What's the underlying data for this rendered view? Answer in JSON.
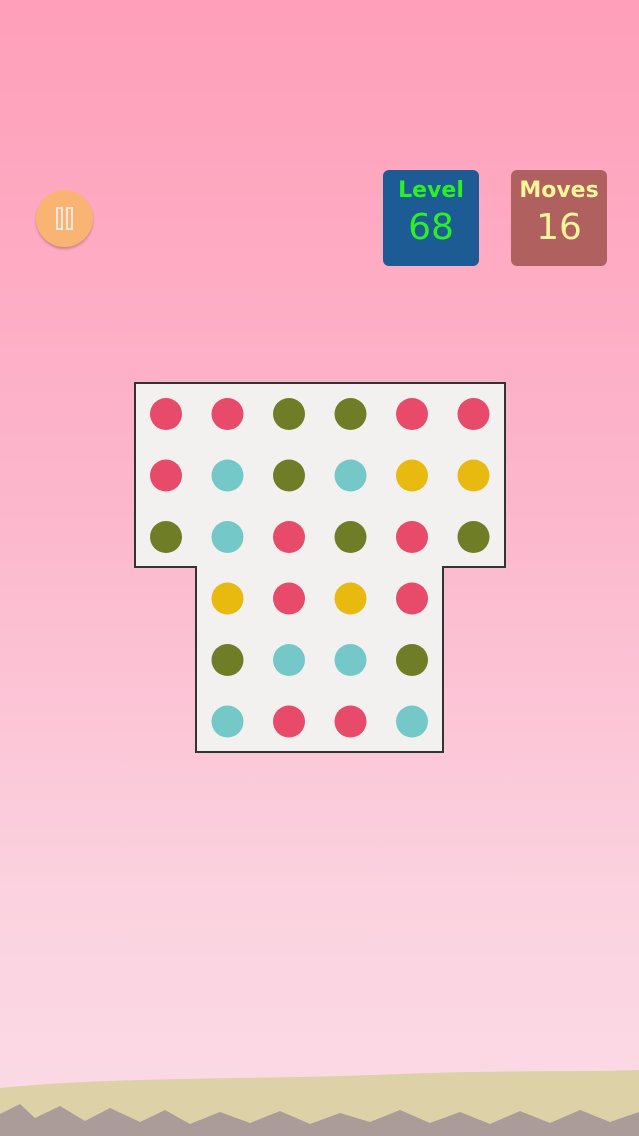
{
  "hud": {
    "level_label": "Level",
    "level_value": "68",
    "moves_label": "Moves",
    "moves_value": "16"
  },
  "board": {
    "colors": {
      "R": "#e84a6a",
      "G": "#6f7d26",
      "C": "#74c9c8",
      "Y": "#e8ba10"
    },
    "rows": [
      [
        "R",
        "R",
        "G",
        "G",
        "R",
        "R"
      ],
      [
        "R",
        "C",
        "G",
        "C",
        "Y",
        "Y"
      ],
      [
        "G",
        "C",
        "R",
        "G",
        "R",
        "G"
      ],
      [
        null,
        "Y",
        "R",
        "Y",
        "R",
        null
      ],
      [
        null,
        "G",
        "C",
        "C",
        "G",
        null
      ],
      [
        null,
        "C",
        "R",
        "R",
        "C",
        null
      ]
    ]
  },
  "colors": {
    "background_top": "#ff9fb9",
    "background_bottom": "#fbdbe6",
    "board_fill": "#f2f1f0",
    "level_box": "#1c5b93",
    "moves_box": "#b0605f",
    "pause_button": "#f9b473"
  }
}
